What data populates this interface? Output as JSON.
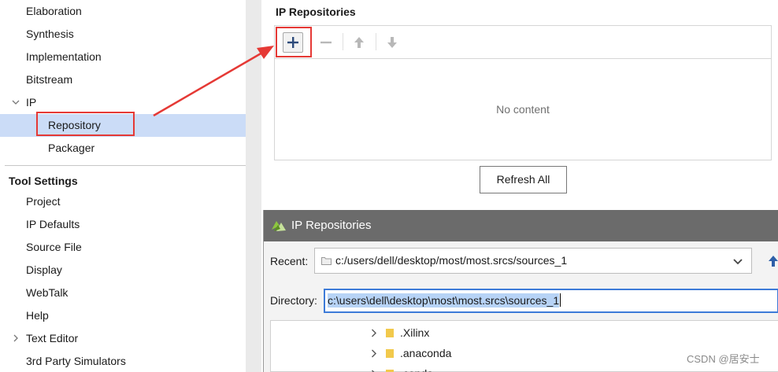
{
  "nav": {
    "items": [
      {
        "label": "Elaboration"
      },
      {
        "label": "Synthesis"
      },
      {
        "label": "Implementation"
      },
      {
        "label": "Bitstream"
      },
      {
        "label": "IP"
      },
      {
        "label": "Repository"
      },
      {
        "label": "Packager"
      }
    ],
    "tool_settings_heading": "Tool Settings",
    "tool_items": [
      {
        "label": "Project"
      },
      {
        "label": "IP Defaults"
      },
      {
        "label": "Source File"
      },
      {
        "label": "Display"
      },
      {
        "label": "WebTalk"
      },
      {
        "label": "Help"
      },
      {
        "label": "Text Editor"
      },
      {
        "label": "3rd Party Simulators"
      }
    ],
    "selected_item": "Repository"
  },
  "ip_panel": {
    "title": "IP Repositories",
    "empty_text": "No content",
    "toolbar_icons": [
      "plus-icon",
      "minus-icon",
      "arrow-up-icon",
      "arrow-down-icon"
    ],
    "refresh_label": "Refresh All"
  },
  "dialog": {
    "title": "IP Repositories",
    "recent_label": "Recent:",
    "recent_value": "c:/users/dell/desktop/most/most.srcs/sources_1",
    "directory_label": "Directory:",
    "directory_value": "c:\\users\\dell\\desktop\\most\\most.srcs\\sources_1",
    "tree": [
      {
        "name": ".Xilinx"
      },
      {
        "name": ".anaconda"
      },
      {
        "name": ".conda"
      }
    ]
  },
  "watermark": "CSDN @居安士",
  "colors": {
    "selection": "#cbdcf7",
    "highlight": "#e53935",
    "focus": "#3d7bd8",
    "dialog_titlebar": "#6b6b6b"
  }
}
